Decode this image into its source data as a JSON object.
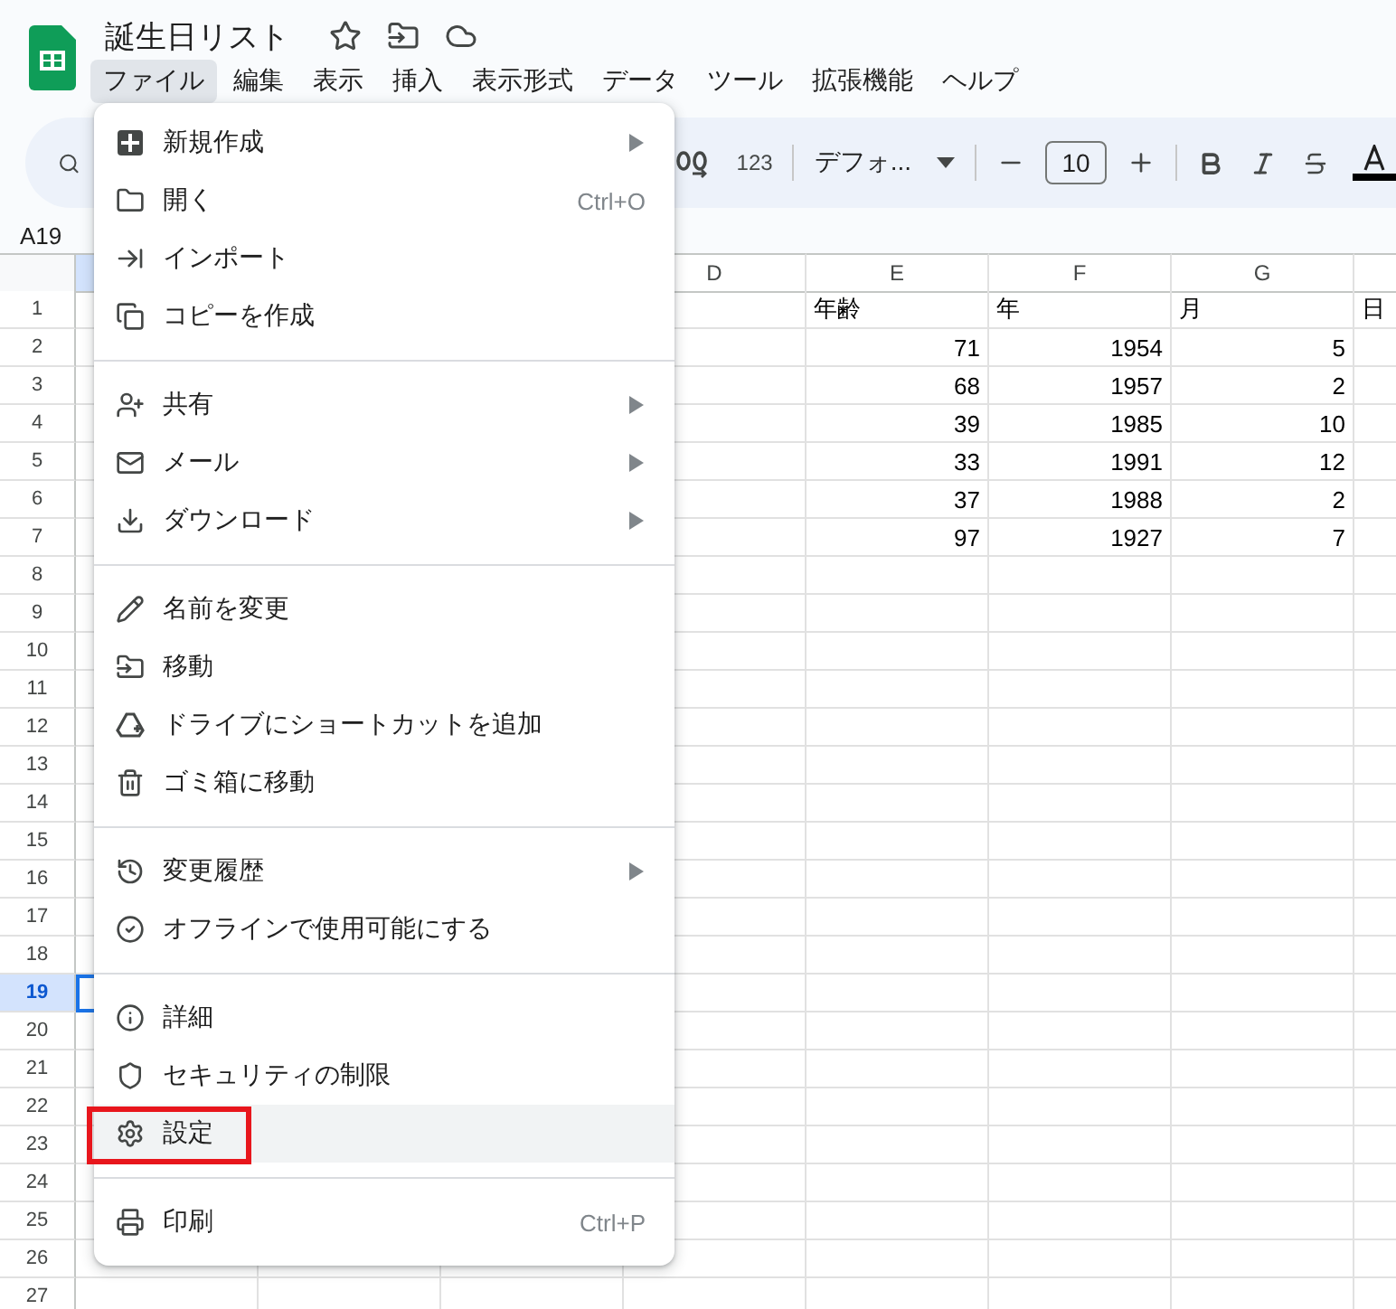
{
  "document": {
    "title": "誕生日リスト"
  },
  "menu_bar": [
    {
      "label": "ファイル",
      "selected": true
    },
    {
      "label": "編集",
      "selected": false
    },
    {
      "label": "表示",
      "selected": false
    },
    {
      "label": "挿入",
      "selected": false
    },
    {
      "label": "表示形式",
      "selected": false
    },
    {
      "label": "データ",
      "selected": false
    },
    {
      "label": "ツール",
      "selected": false
    },
    {
      "label": "拡張機能",
      "selected": false
    },
    {
      "label": "ヘルプ",
      "selected": false
    }
  ],
  "toolbar": {
    "number_format": "123",
    "font": "デフォ...",
    "font_size": "10"
  },
  "name_box": "A19",
  "sheet": {
    "columns": [
      {
        "selected": true
      },
      {},
      {},
      {
        "label": "D",
        "selected": false
      },
      {
        "label": "E",
        "selected": false
      },
      {
        "label": "F",
        "selected": false
      },
      {
        "label": "G",
        "selected": false
      },
      {
        "selected": false
      }
    ],
    "rows": [
      {
        "number": "1",
        "selected": false,
        "kind": "header",
        "column_e": "年齢",
        "column_f": "年",
        "column_g": "月",
        "column_h": "日"
      },
      {
        "number": "2",
        "selected": false,
        "kind": "data",
        "column_e": "71",
        "column_f": "1954",
        "column_g": "5"
      },
      {
        "number": "3",
        "selected": false,
        "kind": "data",
        "column_e": "68",
        "column_f": "1957",
        "column_g": "2"
      },
      {
        "number": "4",
        "selected": false,
        "kind": "data",
        "column_e": "39",
        "column_f": "1985",
        "column_g": "10"
      },
      {
        "number": "5",
        "selected": false,
        "kind": "data",
        "column_e": "33",
        "column_f": "1991",
        "column_g": "12"
      },
      {
        "number": "6",
        "selected": false,
        "kind": "data",
        "column_e": "37",
        "column_f": "1988",
        "column_g": "2"
      },
      {
        "number": "7",
        "selected": false,
        "kind": "data",
        "column_e": "97",
        "column_f": "1927",
        "column_g": "7"
      },
      {
        "number": "8",
        "selected": false
      },
      {
        "number": "9",
        "selected": false
      },
      {
        "number": "10",
        "selected": false
      },
      {
        "number": "11",
        "selected": false
      },
      {
        "number": "12",
        "selected": false
      },
      {
        "number": "13",
        "selected": false
      },
      {
        "number": "14",
        "selected": false
      },
      {
        "number": "15",
        "selected": false
      },
      {
        "number": "16",
        "selected": false
      },
      {
        "number": "17",
        "selected": false
      },
      {
        "number": "18",
        "selected": false
      },
      {
        "number": "19",
        "selected": true
      },
      {
        "number": "20",
        "selected": false
      },
      {
        "number": "21",
        "selected": false
      },
      {
        "number": "22",
        "selected": false
      },
      {
        "number": "23",
        "selected": false
      },
      {
        "number": "24",
        "selected": false
      },
      {
        "number": "25",
        "selected": false
      },
      {
        "number": "26",
        "selected": false
      },
      {
        "number": "27",
        "selected": false
      }
    ]
  },
  "file_menu": {
    "sections": [
      {
        "items": [
          {
            "label": "新規作成",
            "submenu": true,
            "highlighted": false,
            "outlined": false
          },
          {
            "label": "開く",
            "shortcut": "Ctrl+O",
            "submenu": false,
            "highlighted": false,
            "outlined": false
          },
          {
            "label": "インポート",
            "submenu": false,
            "highlighted": false,
            "outlined": false
          },
          {
            "label": "コピーを作成",
            "submenu": false,
            "highlighted": false,
            "outlined": false
          }
        ]
      },
      {
        "items": [
          {
            "label": "共有",
            "submenu": true,
            "highlighted": false,
            "outlined": false
          },
          {
            "label": "メール",
            "submenu": true,
            "highlighted": false,
            "outlined": false
          },
          {
            "label": "ダウンロード",
            "submenu": true,
            "highlighted": false,
            "outlined": false
          }
        ]
      },
      {
        "items": [
          {
            "label": "名前を変更",
            "submenu": false,
            "highlighted": false,
            "outlined": false
          },
          {
            "label": "移動",
            "submenu": false,
            "highlighted": false,
            "outlined": false
          },
          {
            "label": "ドライブにショートカットを追加",
            "submenu": false,
            "highlighted": false,
            "outlined": false
          },
          {
            "label": "ゴミ箱に移動",
            "submenu": false,
            "highlighted": false,
            "outlined": false
          }
        ]
      },
      {
        "items": [
          {
            "label": "変更履歴",
            "submenu": true,
            "highlighted": false,
            "outlined": false
          },
          {
            "label": "オフラインで使用可能にする",
            "submenu": false,
            "highlighted": false,
            "outlined": false
          }
        ]
      },
      {
        "items": [
          {
            "label": "詳細",
            "submenu": false,
            "highlighted": false,
            "outlined": false
          },
          {
            "label": "セキュリティの制限",
            "submenu": false,
            "highlighted": false,
            "outlined": false
          },
          {
            "label": "設定",
            "submenu": false,
            "highlighted": true,
            "outlined": true
          }
        ]
      },
      {
        "items": [
          {
            "label": "印刷",
            "shortcut": "Ctrl+P",
            "submenu": false,
            "highlighted": false,
            "outlined": false
          }
        ]
      }
    ]
  }
}
